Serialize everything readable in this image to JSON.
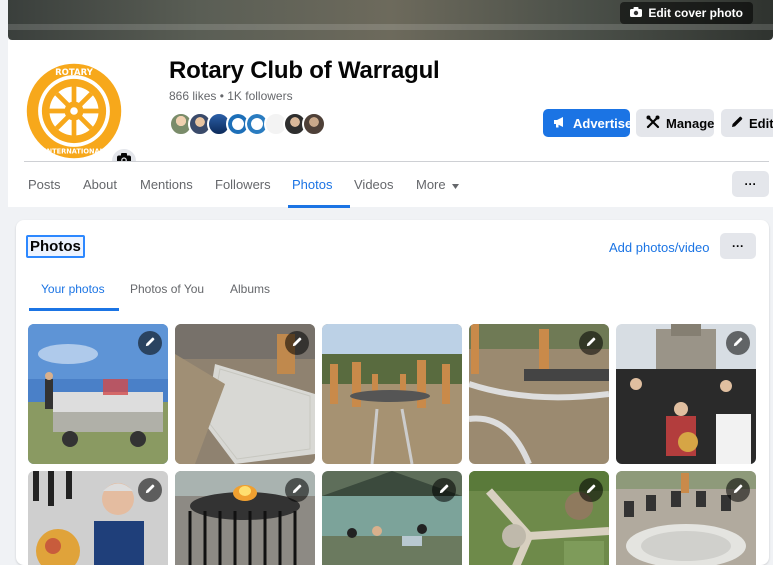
{
  "cover": {
    "edit_label": "Edit cover photo"
  },
  "page": {
    "title": "Rotary Club of Warragul",
    "stats": "866 likes • 1K followers",
    "logo_text_top": "ROTARY",
    "logo_text_bottom": "INTERNATIONAL"
  },
  "actions": {
    "advertise": "Advertise",
    "manage": "Manage",
    "edit": "Edit"
  },
  "nav": {
    "tabs": [
      "Posts",
      "About",
      "Mentions",
      "Followers",
      "Photos",
      "Videos",
      "More"
    ],
    "active": "Photos",
    "more_menu": "···"
  },
  "photos_section": {
    "title": "Photos",
    "add_label": "Add photos/video",
    "more_menu": "···",
    "tabs": [
      "Your photos",
      "Photos of You",
      "Albums"
    ],
    "active_tab": "Your photos"
  },
  "colors": {
    "accent": "#1b74e4",
    "rotary_gold": "#f7a81b",
    "rotary_blue": "#17458f"
  }
}
